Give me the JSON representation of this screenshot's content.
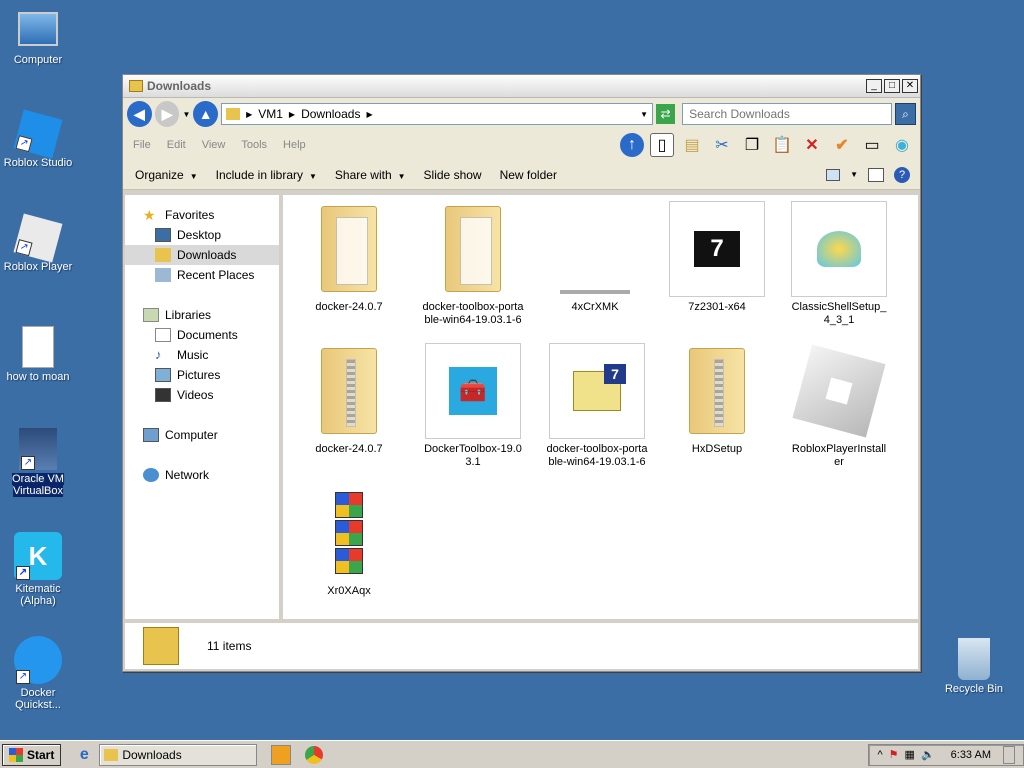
{
  "desktop": {
    "icons": [
      {
        "label": "Computer"
      },
      {
        "label": "Roblox Studio"
      },
      {
        "label": "Roblox Player"
      },
      {
        "label": "how to moan"
      },
      {
        "label": "Oracle VM VirtualBox"
      },
      {
        "label": "Kitematic (Alpha)"
      },
      {
        "label": "Docker Quickst..."
      },
      {
        "label": "Recycle Bin"
      }
    ]
  },
  "window": {
    "title": "Downloads",
    "address": {
      "root": "VM1",
      "folder": "Downloads"
    },
    "search_placeholder": "Search Downloads",
    "menu": [
      "File",
      "Edit",
      "View",
      "Tools",
      "Help"
    ],
    "commands": [
      {
        "label": "Organize"
      },
      {
        "label": "Include in library"
      },
      {
        "label": "Share with"
      },
      {
        "label": "Slide show"
      },
      {
        "label": "New folder"
      }
    ],
    "nav": {
      "favorites": "Favorites",
      "desktop": "Desktop",
      "downloads": "Downloads",
      "recent": "Recent Places",
      "libraries": "Libraries",
      "documents": "Documents",
      "music": "Music",
      "pictures": "Pictures",
      "videos": "Videos",
      "computer": "Computer",
      "network": "Network"
    },
    "files": [
      {
        "name": "docker-24.0.7"
      },
      {
        "name": "docker-toolbox-portable-win64-19.03.1-6"
      },
      {
        "name": "4xCrXMK"
      },
      {
        "name": "7z2301-x64"
      },
      {
        "name": "ClassicShellSetup_4_3_1"
      },
      {
        "name": "docker-24.0.7"
      },
      {
        "name": "DockerToolbox-19.03.1"
      },
      {
        "name": "docker-toolbox-portable-win64-19.03.1-6"
      },
      {
        "name": "HxDSetup"
      },
      {
        "name": "RobloxPlayerInstaller"
      },
      {
        "name": "Xr0XAqx"
      }
    ],
    "status": "11 items"
  },
  "taskbar": {
    "start": "Start",
    "task": "Downloads",
    "clock": "6:33 AM"
  }
}
